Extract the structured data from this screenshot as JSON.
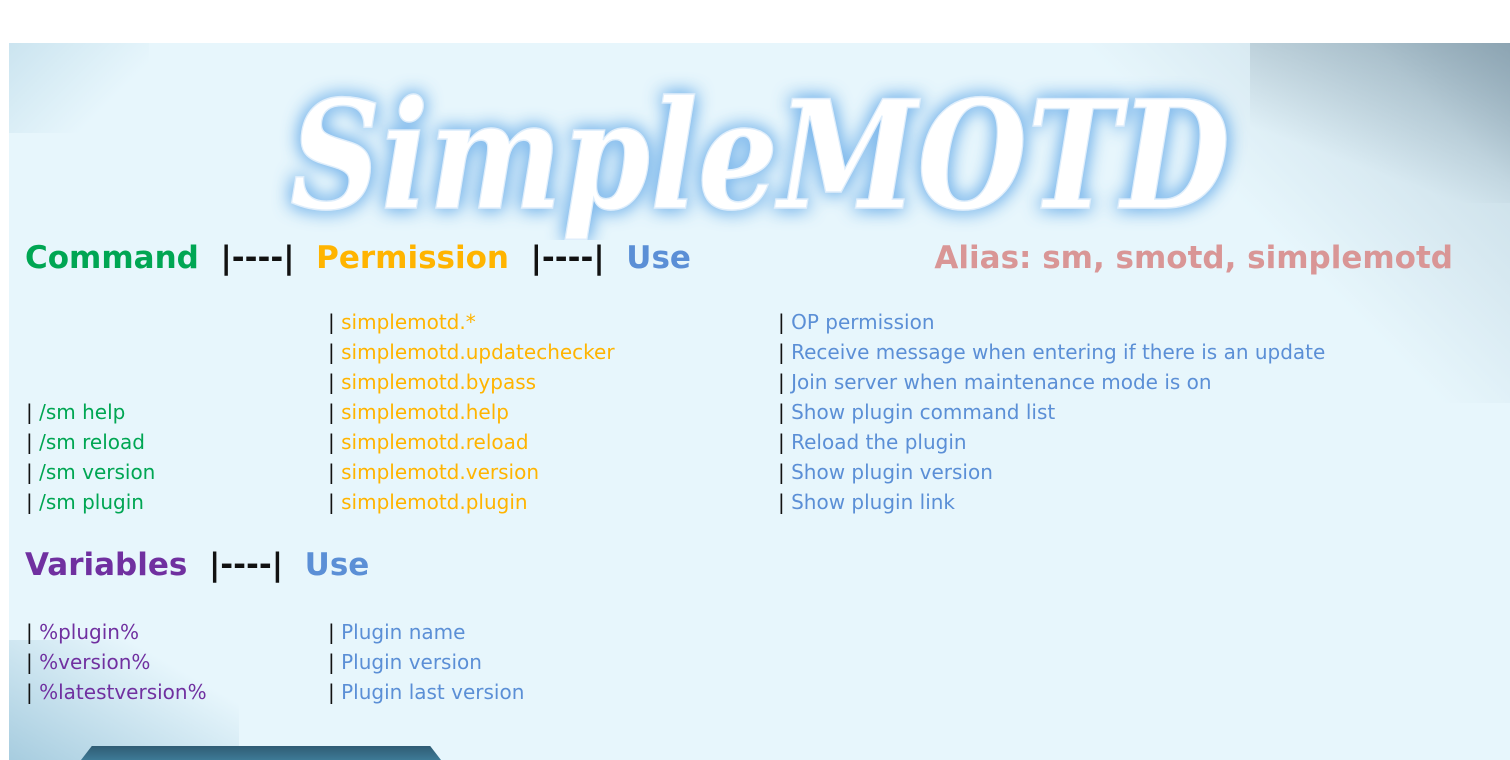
{
  "logo": {
    "text": "SimpleMOTD"
  },
  "commands_header": {
    "command": "Command",
    "separator1": "|----|",
    "permission": "Permission",
    "separator2": "|----|",
    "use": "Use"
  },
  "alias": "Alias: sm, smotd, simplemotd",
  "commands": [
    {
      "command": "",
      "permission": "simplemotd.*",
      "use": "OP permission"
    },
    {
      "command": "",
      "permission": "simplemotd.updatechecker",
      "use": "Receive message when entering if there is an update"
    },
    {
      "command": "",
      "permission": "simplemotd.bypass",
      "use": "Join server when maintenance mode is on"
    },
    {
      "command": "/sm help",
      "permission": "simplemotd.help",
      "use": "Show plugin command list"
    },
    {
      "command": "/sm reload",
      "permission": "simplemotd.reload",
      "use": "Reload the plugin"
    },
    {
      "command": "/sm version",
      "permission": "simplemotd.version",
      "use": "Show plugin version"
    },
    {
      "command": "/sm plugin",
      "permission": "simplemotd.plugin",
      "use": "Show plugin link"
    }
  ],
  "variables_header": {
    "variables": "Variables",
    "separator": "|----|",
    "use": "Use"
  },
  "variables": [
    {
      "name": "%plugin%",
      "use": "Plugin name"
    },
    {
      "name": "%version%",
      "use": "Plugin version"
    },
    {
      "name": "%latestversion%",
      "use": "Plugin last version"
    }
  ],
  "separator_char": "|",
  "colors": {
    "command": "#00a653",
    "permission": "#ffb400",
    "use": "#5b8fd6",
    "variables": "#7030a0",
    "alias": "#d99696",
    "background": "#e7f6fc",
    "logo_glow": "#7fb9ec"
  }
}
